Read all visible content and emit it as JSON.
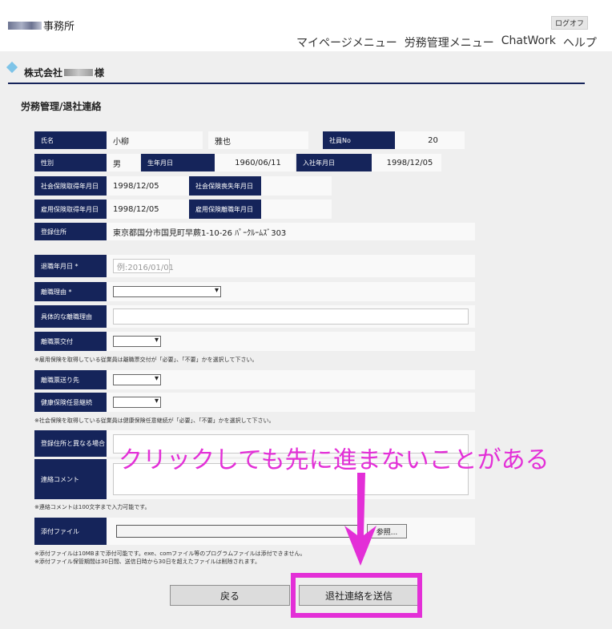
{
  "header": {
    "office_name": "事務所",
    "logout": "ログオフ",
    "nav": [
      "マイページメニュー",
      "労務管理メニュー",
      "ChatWork",
      "ヘルプ"
    ]
  },
  "company": {
    "prefix": "株式会社",
    "suffix": "様"
  },
  "section_title": "労務管理/退社連絡",
  "employee": {
    "name_label": "氏名",
    "last_name": "小柳",
    "first_name": "雅也",
    "empno_label": "社員No",
    "empno": "20",
    "gender_label": "性別",
    "gender": "男",
    "birth_label": "生年月日",
    "birth": "1960/06/11",
    "hire_label": "入社年月日",
    "hire": "1998/12/05",
    "si_get_label": "社会保険取得年月日",
    "si_get": "1998/12/05",
    "si_lost_label": "社会保険喪失年月日",
    "ei_get_label": "雇用保険取得年月日",
    "ei_get": "1998/12/05",
    "ei_leave_label": "雇用保険離職年月日",
    "addr_label": "登録住所",
    "addr": "東京都国分市国見町早蕨1-10-26 ﾊﾟｰｸﾙｰﾑｽﾞ303"
  },
  "form": {
    "retire_date_label": "退職年月日 *",
    "retire_date_placeholder": "例:2016/01/01",
    "reason_label": "離職理由 *",
    "detail_label": "具体的な離職理由",
    "slip_label": "離職票交付",
    "note1": "※雇用保険を取得している従業員は離職票交付が「必要」、「不要」かを選択して下さい。",
    "slip_dest_label": "離職票送り先",
    "health_label": "健康保険任意継続",
    "note2": "※社会保険を取得している従業員は健康保険任意継続が「必要」、「不要」かを選択して下さい。",
    "alt_addr_label": "登録住所と異なる場合",
    "comment_label": "連絡コメント",
    "note3": "※連絡コメントは100文字まで入力可能です。",
    "attach_label": "添付ファイル",
    "browse": "参照...",
    "note4": "※添付ファイルは10MBまで添付可能です。exe、comファイル等のプログラムファイルは添付できません。",
    "note5": "※添付ファイル保管期間は30日間、送信日時から30日を超えたファイルは削除されます。"
  },
  "buttons": {
    "back": "戻る",
    "send": "退社連絡を送信"
  },
  "annotation": {
    "text": "クリックしても先に進まないことがある",
    "color": "#e32fd7"
  },
  "colors": {
    "label_bg": "#15245a",
    "panel_bg": "#efefef",
    "accent": "#7ec4e8"
  }
}
